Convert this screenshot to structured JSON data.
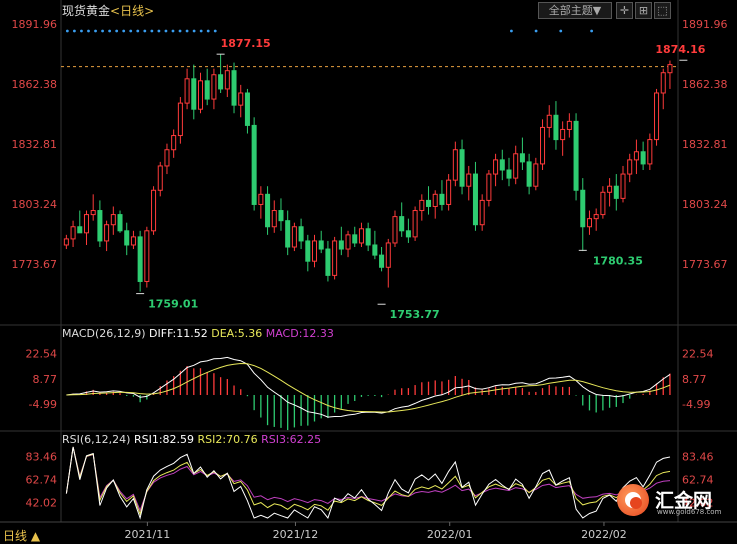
{
  "header": {
    "instrument": "现货黄金",
    "timeframe": "<日线>",
    "theme_button": "全部主题▼",
    "bottom_tab": "日线 ▲"
  },
  "watermark": {
    "brand": "汇金网",
    "url": "www.gold678.com"
  },
  "colors": {
    "up": "#ff3b3b",
    "down": "#2ecc71",
    "dif_line": "#ffffff",
    "dea_line": "#e8e85a",
    "macd_label": "#d040d0",
    "rsi1": "#ffffff",
    "rsi2": "#e8e85a",
    "rsi3": "#c040c0",
    "price_axis_text": "#e04848",
    "ref_line": "#e8a040"
  },
  "chart_data": [
    {
      "type": "candlestick",
      "title": "现货黄金 <日线>",
      "x_ticks": [
        "2021/11",
        "2021/12",
        "2022/01",
        "2022/02"
      ],
      "y_ticks": [
        1891.96,
        1862.38,
        1832.81,
        1803.24,
        1773.67
      ],
      "ylim": [
        1745,
        1895
      ],
      "annotations": [
        {
          "label": "1877.15",
          "value": 1877.15
        },
        {
          "label": "1874.16",
          "value": 1874.16
        },
        {
          "label": "1759.01",
          "value": 1759.01
        },
        {
          "label": "1753.77",
          "value": 1753.77
        },
        {
          "label": "1780.35",
          "value": 1780.35
        }
      ],
      "reference_line": 1871.0,
      "ohlc": [
        [
          1783,
          1788,
          1781,
          1786
        ],
        [
          1786,
          1795,
          1782,
          1792
        ],
        [
          1792,
          1800,
          1789,
          1789
        ],
        [
          1789,
          1800,
          1783,
          1798
        ],
        [
          1798,
          1808,
          1795,
          1800
        ],
        [
          1800,
          1805,
          1782,
          1785
        ],
        [
          1785,
          1795,
          1780,
          1793
        ],
        [
          1793,
          1802,
          1788,
          1798
        ],
        [
          1798,
          1800,
          1789,
          1790
        ],
        [
          1790,
          1794,
          1778,
          1783
        ],
        [
          1783,
          1790,
          1781,
          1787
        ],
        [
          1787,
          1790,
          1760,
          1765
        ],
        [
          1765,
          1792,
          1762,
          1790
        ],
        [
          1790,
          1812,
          1788,
          1810
        ],
        [
          1810,
          1824,
          1807,
          1822
        ],
        [
          1822,
          1833,
          1818,
          1830
        ],
        [
          1830,
          1840,
          1826,
          1837
        ],
        [
          1837,
          1856,
          1833,
          1853
        ],
        [
          1853,
          1870,
          1850,
          1865
        ],
        [
          1865,
          1872,
          1845,
          1850
        ],
        [
          1850,
          1868,
          1848,
          1864
        ],
        [
          1864,
          1870,
          1852,
          1855
        ],
        [
          1855,
          1870,
          1850,
          1867
        ],
        [
          1867,
          1877,
          1858,
          1860
        ],
        [
          1860,
          1872,
          1856,
          1869
        ],
        [
          1869,
          1873,
          1848,
          1852
        ],
        [
          1852,
          1862,
          1846,
          1858
        ],
        [
          1858,
          1860,
          1838,
          1842
        ],
        [
          1842,
          1846,
          1800,
          1803
        ],
        [
          1803,
          1812,
          1796,
          1808
        ],
        [
          1808,
          1812,
          1788,
          1792
        ],
        [
          1792,
          1805,
          1789,
          1800
        ],
        [
          1800,
          1806,
          1790,
          1795
        ],
        [
          1795,
          1800,
          1778,
          1782
        ],
        [
          1782,
          1794,
          1780,
          1792
        ],
        [
          1792,
          1796,
          1781,
          1785
        ],
        [
          1785,
          1788,
          1770,
          1775
        ],
        [
          1775,
          1788,
          1772,
          1785
        ],
        [
          1785,
          1790,
          1779,
          1781
        ],
        [
          1781,
          1785,
          1765,
          1768
        ],
        [
          1768,
          1787,
          1766,
          1785
        ],
        [
          1785,
          1792,
          1778,
          1781
        ],
        [
          1781,
          1790,
          1777,
          1788
        ],
        [
          1788,
          1792,
          1782,
          1784
        ],
        [
          1784,
          1794,
          1782,
          1791
        ],
        [
          1791,
          1794,
          1780,
          1783
        ],
        [
          1783,
          1790,
          1776,
          1778
        ],
        [
          1778,
          1782,
          1770,
          1772
        ],
        [
          1772,
          1786,
          1762,
          1784
        ],
        [
          1784,
          1800,
          1782,
          1797
        ],
        [
          1797,
          1804,
          1787,
          1790
        ],
        [
          1790,
          1796,
          1784,
          1787
        ],
        [
          1787,
          1802,
          1785,
          1800
        ],
        [
          1800,
          1808,
          1795,
          1805
        ],
        [
          1805,
          1812,
          1798,
          1802
        ],
        [
          1802,
          1810,
          1796,
          1808
        ],
        [
          1808,
          1815,
          1800,
          1803
        ],
        [
          1803,
          1818,
          1800,
          1815
        ],
        [
          1815,
          1834,
          1812,
          1830
        ],
        [
          1830,
          1835,
          1808,
          1812
        ],
        [
          1812,
          1822,
          1805,
          1818
        ],
        [
          1818,
          1824,
          1790,
          1793
        ],
        [
          1793,
          1808,
          1790,
          1805
        ],
        [
          1805,
          1820,
          1802,
          1818
        ],
        [
          1818,
          1828,
          1812,
          1825
        ],
        [
          1825,
          1830,
          1815,
          1820
        ],
        [
          1820,
          1826,
          1812,
          1816
        ],
        [
          1816,
          1832,
          1813,
          1828
        ],
        [
          1828,
          1836,
          1820,
          1824
        ],
        [
          1824,
          1828,
          1808,
          1812
        ],
        [
          1812,
          1826,
          1810,
          1823
        ],
        [
          1823,
          1845,
          1820,
          1841
        ],
        [
          1841,
          1852,
          1836,
          1847
        ],
        [
          1847,
          1854,
          1830,
          1835
        ],
        [
          1835,
          1844,
          1827,
          1840
        ],
        [
          1840,
          1848,
          1836,
          1844
        ],
        [
          1844,
          1848,
          1805,
          1810
        ],
        [
          1810,
          1816,
          1780,
          1792
        ],
        [
          1792,
          1800,
          1788,
          1796
        ],
        [
          1796,
          1801,
          1790,
          1798
        ],
        [
          1798,
          1812,
          1796,
          1809
        ],
        [
          1809,
          1816,
          1802,
          1812
        ],
        [
          1812,
          1818,
          1800,
          1806
        ],
        [
          1806,
          1822,
          1804,
          1818
        ],
        [
          1818,
          1828,
          1814,
          1825
        ],
        [
          1825,
          1835,
          1818,
          1829
        ],
        [
          1829,
          1834,
          1820,
          1823
        ],
        [
          1823,
          1838,
          1820,
          1835
        ],
        [
          1835,
          1860,
          1832,
          1858
        ],
        [
          1858,
          1870,
          1850,
          1868
        ],
        [
          1868,
          1874,
          1860,
          1872
        ]
      ]
    },
    {
      "type": "macd",
      "label": "MACD(26,12,9)",
      "diff_label": "DIFF:11.52",
      "dea_label": "DEA:5.36",
      "macd_label": "MACD:12.33",
      "y_ticks": [
        22.54,
        8.77,
        -4.99
      ],
      "ylim": [
        -18,
        30
      ]
    },
    {
      "type": "rsi",
      "label": "RSI(6,12,24)",
      "rsi1_label": "RSI1:82.59",
      "rsi2_label": "RSI2:70.76",
      "rsi3_label": "RSI3:62.25",
      "y_ticks": [
        83.46,
        62.74,
        42.02
      ],
      "ylim": [
        28,
        92
      ]
    }
  ]
}
